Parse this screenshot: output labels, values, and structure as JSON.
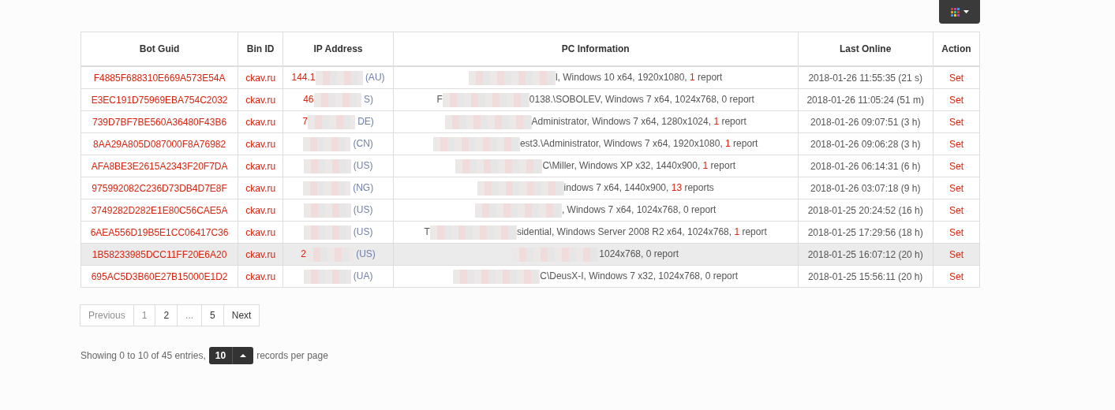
{
  "columns": [
    "Bot Guid",
    "Bin ID",
    "IP Address",
    "PC Information",
    "Last Online",
    "Action"
  ],
  "rows": [
    {
      "guid": "F4885F688310E669A573E54A",
      "bin": "ckav.ru",
      "ip_start": "144.1",
      "ip_end": "(AU)",
      "pc_start": "",
      "pc_end": "l, Windows 10 x64, 1920x1080, ",
      "reports": "1 report",
      "has_reports": true,
      "last": "2018-01-26 11:55:35 (21 s)",
      "action": "Set",
      "highlighted": false
    },
    {
      "guid": "E3EC191D75969EBA754C2032",
      "bin": "ckav.ru",
      "ip_start": "46",
      "ip_end": "S)",
      "pc_start": "F",
      "pc_end": "0138.\\SOBOLEV, Windows 7 x64, 1024x768, ",
      "reports": "0 report",
      "has_reports": false,
      "last": "2018-01-26 11:05:24 (51 m)",
      "action": "Set",
      "highlighted": false
    },
    {
      "guid": "739D7BF7BE560A36480F43B6",
      "bin": "ckav.ru",
      "ip_start": "7",
      "ip_end": "DE)",
      "pc_start": "",
      "pc_end": "Administrator, Windows 7 x64, 1280x1024, ",
      "reports": "1 report",
      "has_reports": true,
      "last": "2018-01-26 09:07:51 (3 h)",
      "action": "Set",
      "highlighted": false
    },
    {
      "guid": "8AA29A805D087000F8A76982",
      "bin": "ckav.ru",
      "ip_start": "",
      "ip_end": "(CN)",
      "pc_start": "",
      "pc_end": "est3.\\Administrator, Windows 7 x64, 1920x1080, ",
      "reports": "1 report",
      "has_reports": true,
      "last": "2018-01-26 09:06:28 (3 h)",
      "action": "Set",
      "highlighted": false
    },
    {
      "guid": "AFA8BE3E2615A2343F20F7DA",
      "bin": "ckav.ru",
      "ip_start": "",
      "ip_end": "(US)",
      "pc_start": "",
      "pc_end": "C\\Miller, Windows XP x32, 1440x900, ",
      "reports": "1 report",
      "has_reports": true,
      "last": "2018-01-26 06:14:31 (6 h)",
      "action": "Set",
      "highlighted": false
    },
    {
      "guid": "975992082C236D73DB4D7E8F",
      "bin": "ckav.ru",
      "ip_start": "",
      "ip_end": "(NG)",
      "pc_start": "",
      "pc_end": "indows 7 x64, 1440x900, ",
      "reports": "13 reports",
      "has_reports": true,
      "last": "2018-01-26 03:07:18 (9 h)",
      "action": "Set",
      "highlighted": false
    },
    {
      "guid": "3749282D282E1E80C56CAE5A",
      "bin": "ckav.ru",
      "ip_start": "",
      "ip_end": "(US)",
      "pc_start": "",
      "pc_end": ", Windows 7 x64, 1024x768, ",
      "reports": "0 report",
      "has_reports": false,
      "last": "2018-01-25 20:24:52 (16 h)",
      "action": "Set",
      "highlighted": false
    },
    {
      "guid": "6AEA556D19B5E1CC06417C36",
      "bin": "ckav.ru",
      "ip_start": "",
      "ip_end": "(US)",
      "pc_start": "T",
      "pc_end": "sidential, Windows Server 2008 R2 x64, 1024x768, ",
      "reports": "1 report",
      "has_reports": true,
      "last": "2018-01-25 17:29:56 (18 h)",
      "action": "Set",
      "highlighted": false
    },
    {
      "guid": "1B58233985DCC11FF20E6A20",
      "bin": "ckav.ru",
      "ip_start": "2",
      "ip_end": "(US)",
      "pc_start": "",
      "pc_end": "1024x768, ",
      "reports": "0 report",
      "has_reports": false,
      "last": "2018-01-25 16:07:12 (20 h)",
      "action": "Set",
      "highlighted": true
    },
    {
      "guid": "695AC5D3B60E27B15000E1D2",
      "bin": "ckav.ru",
      "ip_start": "",
      "ip_end": "(UA)",
      "pc_start": "",
      "pc_end": "C\\DeusX-I, Windows 7 x32, 1024x768, ",
      "reports": "0 report",
      "has_reports": false,
      "last": "2018-01-25 15:56:11 (20 h)",
      "action": "Set",
      "highlighted": false
    }
  ],
  "pagination": [
    {
      "label": "Previous",
      "disabled": true
    },
    {
      "label": "1",
      "disabled": true
    },
    {
      "label": "2",
      "disabled": false
    },
    {
      "label": "...",
      "disabled": true
    },
    {
      "label": "5",
      "disabled": false
    },
    {
      "label": "Next",
      "disabled": false
    }
  ],
  "footer": {
    "summary": "Showing 0 to 10 of 45 entries,",
    "page_size": "10",
    "suffix": "records per page"
  }
}
